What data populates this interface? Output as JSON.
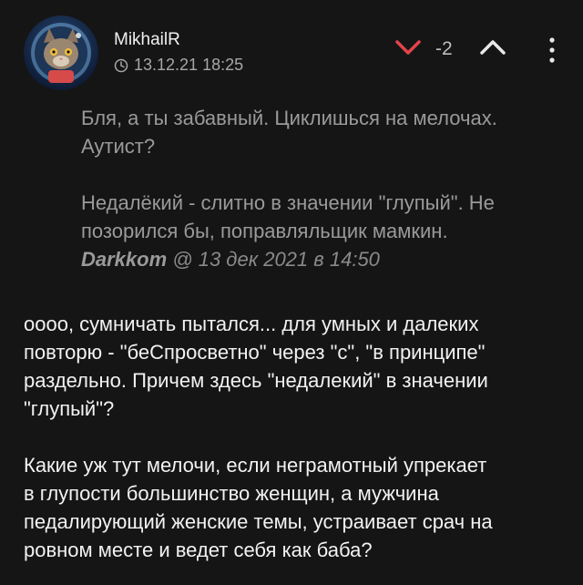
{
  "post": {
    "username": "MikhailR",
    "timestamp": "13.12.21 18:25",
    "score": "-2"
  },
  "icons": {
    "avatar": "astronaut-cat-avatar",
    "clock": "clock-icon",
    "downvote": "chevron-down-icon",
    "upvote": "chevron-up-icon",
    "menu": "more-vertical-icon"
  },
  "colors": {
    "downvote": "#e2444c",
    "background": "#151515"
  },
  "quote": {
    "line1": "Бля, а ты забавный. Циклишься на мелочах.",
    "line2": "Аутист?",
    "line3": "Недалёкий - слитно в значении \"глупый\". Не",
    "line4": "позорился бы, поправляльщик мамкин.",
    "author": "Darkkom",
    "meta": "@ 13 дек 2021 в 14:50"
  },
  "body": {
    "p1_l1": "оооо, сумничать пытался... для умных и далеких",
    "p1_l2": "повторю - \"беСпросветно\" через \"с\", \"в принципе\"",
    "p1_l3": "раздельно. Причем здесь \"недалекий\" в значении",
    "p1_l4": "\"глупый\"?",
    "p2_l1": "Какие уж тут мелочи, если неграмотный упрекает",
    "p2_l2": "в глупости большинство женщин, а мужчина",
    "p2_l3": "педалирующий женские темы, устраивает срач на",
    "p2_l4": "ровном месте и ведет себя как баба?"
  }
}
